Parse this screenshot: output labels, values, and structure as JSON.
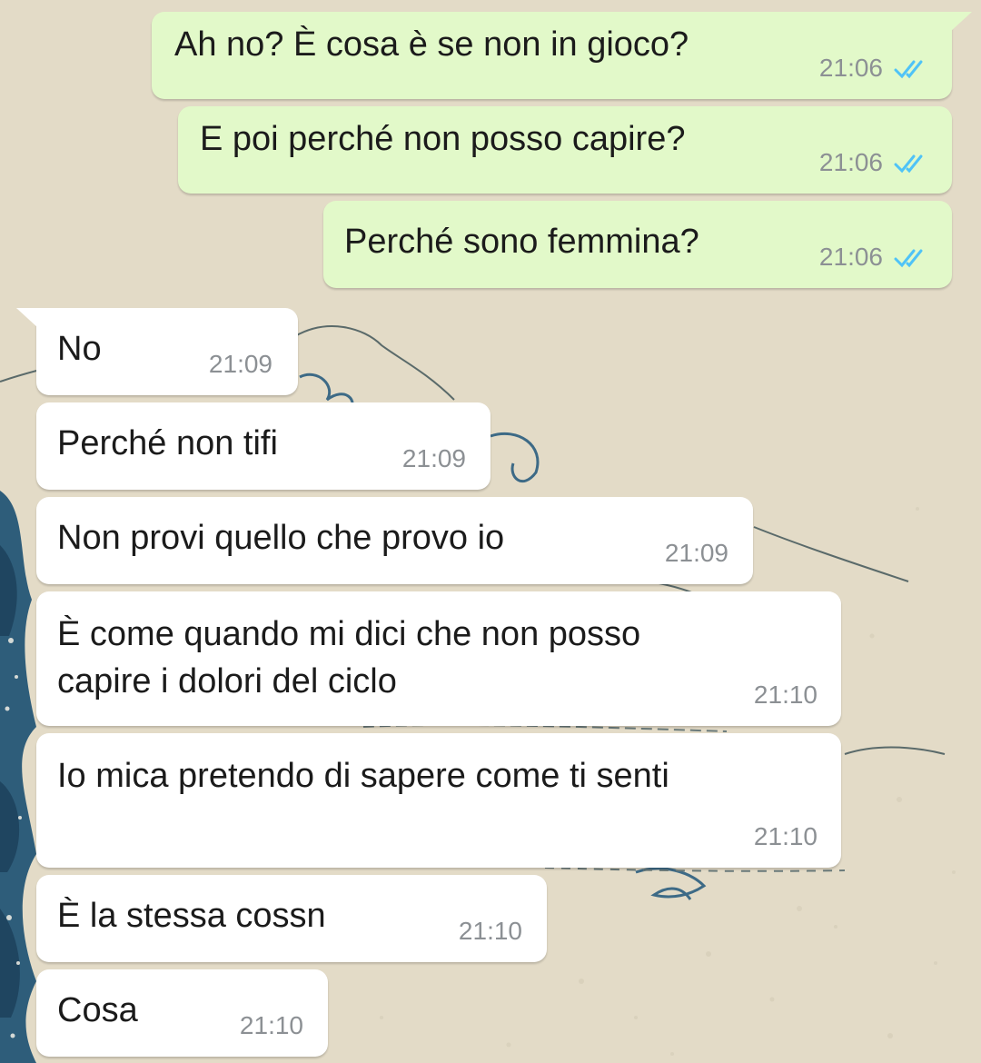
{
  "colors": {
    "outgoing_bubble": "#e2f9c9",
    "incoming_bubble": "#ffffff",
    "timestamp": "#8c9094",
    "read_ticks": "#4fc3f7",
    "wallpaper": "#e3dbc7",
    "wave": "#2e5d7a"
  },
  "icons": {
    "read_ticks": "double-check-icon",
    "wallpaper": "great-wave-wallpaper"
  },
  "messages": [
    {
      "direction": "outgoing",
      "text": "Ah no? È cosa è se non in gioco?",
      "time": "21:06",
      "status": "read"
    },
    {
      "direction": "outgoing",
      "text": "E poi perché non posso capire?",
      "time": "21:06",
      "status": "read"
    },
    {
      "direction": "outgoing",
      "text": "Perché sono femmina?",
      "time": "21:06",
      "status": "read"
    },
    {
      "direction": "incoming",
      "text": "No",
      "time": "21:09"
    },
    {
      "direction": "incoming",
      "text": "Perché non tifi",
      "time": "21:09"
    },
    {
      "direction": "incoming",
      "text": "Non provi quello che provo io",
      "time": "21:09"
    },
    {
      "direction": "incoming",
      "text": "È come quando mi dici che non posso",
      "text_line2": "capire i dolori del ciclo",
      "time": "21:10"
    },
    {
      "direction": "incoming",
      "text": "Io mica pretendo di sapere come ti senti",
      "time": "21:10"
    },
    {
      "direction": "incoming",
      "text": "È la stessa cossn",
      "time": "21:10"
    },
    {
      "direction": "incoming",
      "text": "Cosa",
      "time": "21:10"
    }
  ]
}
